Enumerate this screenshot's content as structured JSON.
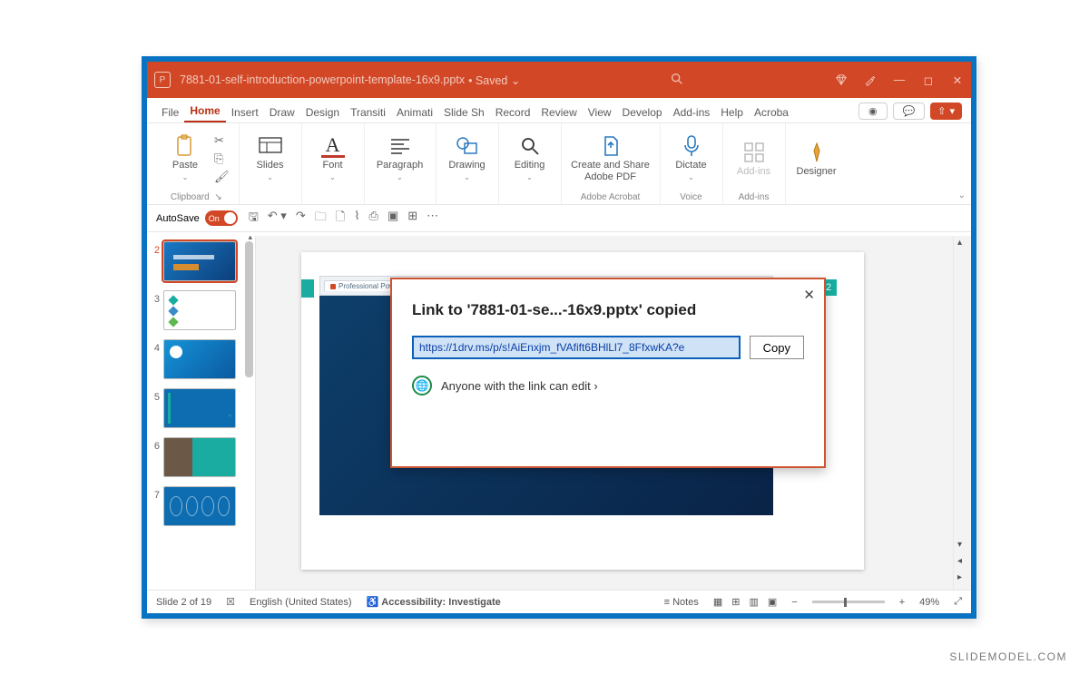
{
  "titlebar": {
    "filename": "7881-01-self-introduction-powerpoint-template-16x9.pptx",
    "saved_label": "• Saved ⌄"
  },
  "tabs": {
    "items": [
      "File",
      "Home",
      "Insert",
      "Draw",
      "Design",
      "Transiti",
      "Animati",
      "Slide Sh",
      "Record",
      "Review",
      "View",
      "Develop",
      "Add-ins",
      "Help",
      "Acroba"
    ],
    "active_index": 1
  },
  "ribbon": {
    "paste": "Paste",
    "clipboard_label": "Clipboard",
    "slides": "Slides",
    "font": "Font",
    "paragraph": "Paragraph",
    "drawing": "Drawing",
    "editing": "Editing",
    "adobe": "Create and Share Adobe PDF",
    "adobe_label": "Adobe Acrobat",
    "dictate": "Dictate",
    "voice_label": "Voice",
    "addins": "Add-ins",
    "addins_label": "Add-ins",
    "designer": "Designer"
  },
  "qat": {
    "autosave_label": "AutoSave",
    "autosave_state": "On"
  },
  "thumbs": {
    "start": 2,
    "items": [
      "2",
      "3",
      "4",
      "5",
      "6",
      "7"
    ],
    "selected": 0
  },
  "slide": {
    "browser_tab": "Professional PowerPoint Temp",
    "badge": "2"
  },
  "dialog": {
    "title": "Link to '7881-01-se...-16x9.pptx' copied",
    "url": "https://1drv.ms/p/s!AiEnxjm_fVAfift6BHlLl7_8FfxwKA?e",
    "copy": "Copy",
    "permission": "Anyone with the link can edit ›"
  },
  "status": {
    "slide_of": "Slide 2 of 19",
    "language": "English (United States)",
    "accessibility": "Accessibility: Investigate",
    "notes": "Notes",
    "zoom": "49%"
  },
  "watermark": "SLIDEMODEL.COM"
}
